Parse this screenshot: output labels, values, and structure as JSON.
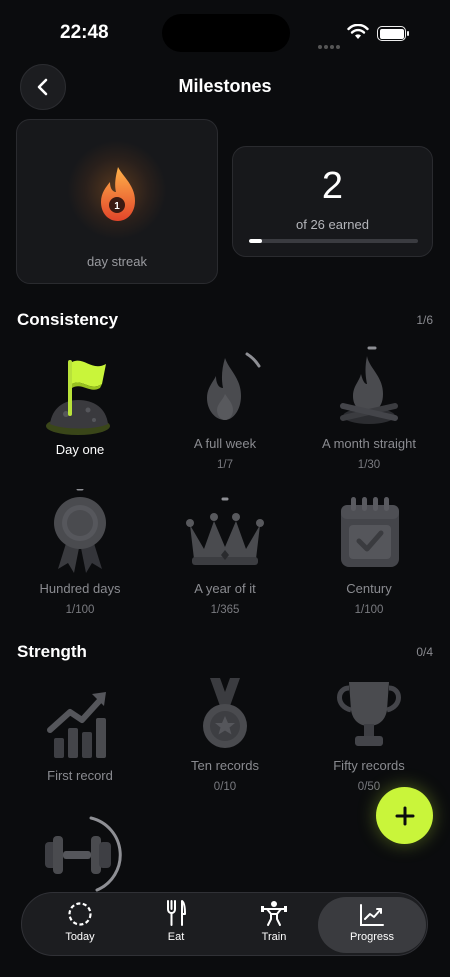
{
  "status_bar": {
    "time": "22:48"
  },
  "header": {
    "title": "Milestones"
  },
  "streak": {
    "number": "1",
    "label": "day streak"
  },
  "earned": {
    "count": "2",
    "label": "of 26 earned",
    "progress": 0.077
  },
  "sections": {
    "consistency": {
      "title": "Consistency",
      "count": "1/6",
      "badges": [
        {
          "name": "Day one",
          "progress": "",
          "earned": true
        },
        {
          "name": "A full week",
          "progress": "1/7",
          "earned": false
        },
        {
          "name": "A month straight",
          "progress": "1/30",
          "earned": false
        },
        {
          "name": "Hundred days",
          "progress": "1/100",
          "earned": false
        },
        {
          "name": "A year of it",
          "progress": "1/365",
          "earned": false
        },
        {
          "name": "Century",
          "progress": "1/100",
          "earned": false
        }
      ]
    },
    "strength": {
      "title": "Strength",
      "count": "0/4",
      "badges": [
        {
          "name": "First record",
          "progress": ""
        },
        {
          "name": "Ten records",
          "progress": "0/10"
        },
        {
          "name": "Fifty records",
          "progress": "0/50"
        },
        {
          "name": "",
          "progress": ""
        }
      ]
    }
  },
  "tabs": [
    {
      "label": "Today",
      "icon": "today-ring-icon"
    },
    {
      "label": "Eat",
      "icon": "fork-knife-icon"
    },
    {
      "label": "Train",
      "icon": "weightlifter-icon"
    },
    {
      "label": "Progress",
      "icon": "trend-chart-icon",
      "active": true
    }
  ],
  "colors": {
    "accent": "#c9f53a",
    "background": "#0b0c0e",
    "card": "#17181b",
    "streak_orange": "#f26a2e"
  }
}
